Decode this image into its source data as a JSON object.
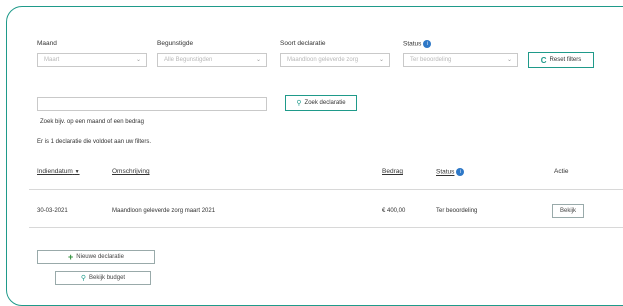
{
  "filters": {
    "month": {
      "label": "Maand",
      "value": "Maart"
    },
    "beneficiary": {
      "label": "Begunstigde",
      "value": "Alle Begunstigden"
    },
    "claim_type": {
      "label": "Soort declaratie",
      "value": "Maandloon geleverde zorg"
    },
    "status": {
      "label": "Status",
      "value": "Ter beoordeling"
    },
    "reset_label": "Reset filters"
  },
  "search": {
    "value": "",
    "button_label": "Zoek declaratie",
    "hint": "Zoek bijv. op een maand of een bedrag"
  },
  "result_text": "Er is 1 declaratie die voldoet aan uw filters.",
  "table": {
    "headers": {
      "date": "Indiendatum",
      "date_sort": "▼",
      "description": "Omschrijving",
      "amount": "Bedrag",
      "status": "Status",
      "action": "Actie"
    },
    "rows": [
      {
        "date": "30-03-2021",
        "description": "Maandloon geleverde zorg maart 2021",
        "amount": "€ 400,00",
        "status": "Ter beoordeling",
        "action": "Bekijk"
      }
    ]
  },
  "actions": {
    "new_claim": "Nieuwe declaratie",
    "view_budget": "Bekijk budget"
  },
  "colors": {
    "accent": "#1f9a8a",
    "info": "#2e78c7",
    "plus": "#2f8f3a"
  }
}
